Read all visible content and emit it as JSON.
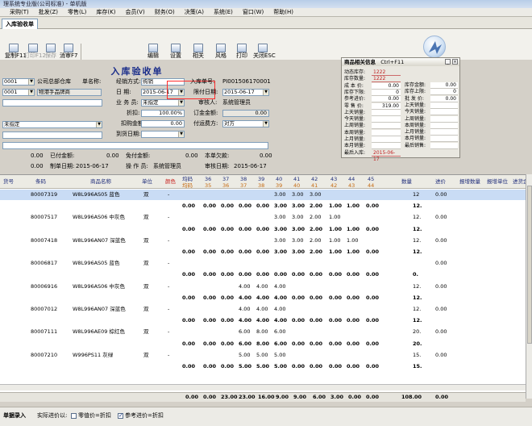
{
  "window": {
    "title": "理系统专业版(公司标准) - 单机版"
  },
  "menu": [
    "采购(T)",
    "批发(Z)",
    "零售(L)",
    "库存(K)",
    "会员(V)",
    "财务(O)",
    "决策(A)",
    "系统(E)",
    "窗口(W)",
    "帮助(H)"
  ],
  "tab": {
    "label": "入库验收单"
  },
  "toolbar": [
    {
      "label": "复制F11"
    },
    {
      "label": "打印F12"
    },
    {
      "label": "保存"
    },
    {
      "label": "存为草稿"
    },
    {
      "label": "消审F7"
    },
    {
      "label": "编辑"
    },
    {
      "label": "设置"
    },
    {
      "label": "相关"
    },
    {
      "label": "风格"
    },
    {
      "label": "打印"
    },
    {
      "label": "关闭ESC"
    }
  ],
  "form": {
    "title": "入库验收单",
    "company_code": "0001",
    "company_name": "公司总部仓库",
    "supplier_label": "单名称:",
    "store_code": "0001",
    "store_name": "物港手品牌商",
    "empty_select1": "",
    "not_set": "未指定",
    "check_method_label": "经销方式:",
    "check_method": "购销",
    "date_label": "日    期:",
    "date": "2015-06-17",
    "order_no_label": "入库单号:",
    "order_no": "PI001506170001",
    "limit_date_label": "限付日期:",
    "limit_date": "2015-06-17",
    "salesman_label": "业 务 员:",
    "salesman": "未指定",
    "auditor_label": "审核人:",
    "auditor": "系统管理员",
    "discount_label": "折扣:",
    "discount": "100.00%",
    "order_amount_label": "订金金额:",
    "order_amount": "0.00",
    "rebate_label": "扣购金额:",
    "rebate": "0.00",
    "pay_method_label": "付运费方:",
    "pay_method": "对方",
    "arrival_label": "到货日期:",
    "arrival": "",
    "inbound_label": "已付金额:",
    "inbound_value": "0.00",
    "paid_label": "免付金额:",
    "paid_value": "0.00",
    "this_debt_label": "本单欠款:",
    "this_debt": "0.00",
    "amount_left": "0.00",
    "amount_left2": "0.00",
    "maker_label": "制单日期:",
    "maker_date": "2015-06-17",
    "operator_label": "操 作 员:",
    "operator": "系统管理员",
    "audit_date_label": "审核日期:",
    "audit_date": "2015-06-17"
  },
  "popup": {
    "title": "商品相关信息",
    "shortcut": "Ctrl+F11",
    "close": "×",
    "left_labels": [
      "动态库存:",
      "库存数量:",
      "成 本 价:",
      "库存下限:",
      "参考进价:",
      "零 售 价:",
      "上天销量:",
      "今天销量:",
      "上周销量:",
      "本周销量:",
      "上月销量:",
      "本月销量:",
      "最后入库:"
    ],
    "left_values": [
      "1222",
      "1222",
      "0.00",
      "0",
      "0.00",
      "319.00",
      "",
      "",
      "",
      "",
      "",
      "",
      "2015-06-17"
    ],
    "right_labels": [
      "库存金额:",
      "库存上限:",
      "批 发 价:",
      "上天销量:",
      "今天销量:",
      "上周销量:",
      "本周销量:",
      "上月销量:",
      "本月销量:",
      "最后销售:"
    ],
    "right_values": [
      "0.00",
      "0",
      "0.00",
      "",
      "",
      "",
      "",
      "",
      "",
      ""
    ]
  },
  "grid": {
    "headers": [
      "货号",
      "条码",
      "商品名称",
      "单位",
      "颜色",
      "数量",
      "进价",
      "报增数量",
      "报增单位",
      "进货金"
    ],
    "size_row1": [
      "均码",
      "36",
      "37",
      "38",
      "39",
      "40",
      "41",
      "42",
      "43",
      "44",
      "45"
    ],
    "size_row2": [
      "均码",
      "35",
      "36",
      "37",
      "38",
      "39",
      "40",
      "41",
      "42",
      "43",
      "44"
    ],
    "rows": [
      {
        "code": "80007319",
        "barcode": "",
        "name": "W8L996AS05 蓝色",
        "unit": "双",
        "color": "-",
        "sizes": [
          "",
          "",
          "",
          "",
          "",
          "3.00",
          "3.00",
          "3.00",
          "",
          "",
          ""
        ],
        "qty": "12",
        "price": "0.00",
        "extra": ""
      },
      {
        "code": "",
        "barcode": "",
        "name": "",
        "unit": "",
        "color": "",
        "sizes": [
          "0.00",
          "0.00",
          "0.00",
          "0.00",
          "0.00",
          "3.00",
          "3.00",
          "2.00",
          "1.00",
          "1.00",
          "0.00"
        ],
        "qty": "12.",
        "price": "",
        "extra": ""
      },
      {
        "code": "80007517",
        "barcode": "",
        "name": "W8L996AS06 中灰色",
        "unit": "双",
        "color": "-",
        "sizes": [
          "",
          "",
          "",
          "",
          "",
          "3.00",
          "3.00",
          "2.00",
          "1.00",
          "",
          ""
        ],
        "qty": "12.",
        "price": "0.00",
        "extra": ""
      },
      {
        "code": "",
        "barcode": "",
        "name": "",
        "unit": "",
        "color": "",
        "sizes": [
          "0.00",
          "0.00",
          "0.00",
          "0.00",
          "0.00",
          "3.00",
          "3.00",
          "2.00",
          "1.00",
          "1.00",
          "0.00"
        ],
        "qty": "12.",
        "price": "",
        "extra": ""
      },
      {
        "code": "80007418",
        "barcode": "",
        "name": "W8L996AN07 深蓝色",
        "unit": "双",
        "color": "-",
        "sizes": [
          "",
          "",
          "",
          "",
          "",
          "3.00",
          "3.00",
          "2.00",
          "1.00",
          "1.00",
          ""
        ],
        "qty": "12.",
        "price": "0.00",
        "extra": ""
      },
      {
        "code": "",
        "barcode": "",
        "name": "",
        "unit": "",
        "color": "",
        "sizes": [
          "0.00",
          "0.00",
          "0.00",
          "0.00",
          "0.00",
          "3.00",
          "3.00",
          "2.00",
          "1.00",
          "1.00",
          "0.00"
        ],
        "qty": "12.",
        "price": "",
        "extra": ""
      },
      {
        "code": "80006817",
        "barcode": "",
        "name": "W8L996AS05 蓝色",
        "unit": "双",
        "color": "-",
        "sizes": [
          "",
          "",
          "",
          "",
          "",
          "",
          "",
          "",
          "",
          "",
          ""
        ],
        "qty": "",
        "price": "0.00",
        "extra": ""
      },
      {
        "code": "",
        "barcode": "",
        "name": "",
        "unit": "",
        "color": "",
        "sizes": [
          "0.00",
          "0.00",
          "0.00",
          "0.00",
          "0.00",
          "0.00",
          "0.00",
          "0.00",
          "0.00",
          "0.00",
          "0.00"
        ],
        "qty": "0.",
        "price": "",
        "extra": ""
      },
      {
        "code": "80006916",
        "barcode": "",
        "name": "W8L996AS06 中灰色",
        "unit": "双",
        "color": "-",
        "sizes": [
          "",
          "",
          "",
          "4.00",
          "4.00",
          "4.00",
          "",
          "",
          "",
          "",
          ""
        ],
        "qty": "12.",
        "price": "0.00",
        "extra": ""
      },
      {
        "code": "",
        "barcode": "",
        "name": "",
        "unit": "",
        "color": "",
        "sizes": [
          "0.00",
          "0.00",
          "0.00",
          "4.00",
          "4.00",
          "4.00",
          "0.00",
          "0.00",
          "0.00",
          "0.00",
          "0.00"
        ],
        "qty": "12.",
        "price": "",
        "extra": ""
      },
      {
        "code": "80007012",
        "barcode": "",
        "name": "W8L996AN07 深蓝色",
        "unit": "双",
        "color": "-",
        "sizes": [
          "",
          "",
          "",
          "4.00",
          "4.00",
          "4.00",
          "",
          "",
          "",
          "",
          ""
        ],
        "qty": "12.",
        "price": "0.00",
        "extra": ""
      },
      {
        "code": "",
        "barcode": "",
        "name": "",
        "unit": "",
        "color": "",
        "sizes": [
          "0.00",
          "0.00",
          "0.00",
          "4.00",
          "4.00",
          "4.00",
          "0.00",
          "0.00",
          "0.00",
          "0.00",
          "0.00"
        ],
        "qty": "12.",
        "price": "",
        "extra": ""
      },
      {
        "code": "80007111",
        "barcode": "",
        "name": "W8L996AE09 棕红色",
        "unit": "双",
        "color": "-",
        "sizes": [
          "",
          "",
          "",
          "6.00",
          "8.00",
          "6.00",
          "",
          "",
          "",
          "",
          ""
        ],
        "qty": "20.",
        "price": "0.00",
        "extra": ""
      },
      {
        "code": "",
        "barcode": "",
        "name": "",
        "unit": "",
        "color": "",
        "sizes": [
          "0.00",
          "0.00",
          "0.00",
          "6.00",
          "8.00",
          "6.00",
          "0.00",
          "0.00",
          "0.00",
          "0.00",
          "0.00"
        ],
        "qty": "20.",
        "price": "",
        "extra": ""
      },
      {
        "code": "80007210",
        "barcode": "",
        "name": "W996PS11 灰绿",
        "unit": "双",
        "color": "-",
        "sizes": [
          "",
          "",
          "",
          "5.00",
          "5.00",
          "5.00",
          "",
          "",
          "",
          "",
          ""
        ],
        "qty": "15.",
        "price": "0.00",
        "extra": ""
      },
      {
        "code": "",
        "barcode": "",
        "name": "",
        "unit": "",
        "color": "",
        "sizes": [
          "0.00",
          "0.00",
          "0.00",
          "5.00",
          "5.00",
          "5.00",
          "0.00",
          "0.00",
          "0.00",
          "0.00",
          "0.00"
        ],
        "qty": "15.",
        "price": "",
        "extra": ""
      }
    ]
  },
  "totals": {
    "sizes": [
      "0.00",
      "0.00",
      "23.00",
      "23.00",
      "16.00",
      "9.00",
      "9.00",
      "6.00",
      "3.00",
      "0.00",
      "0.00"
    ],
    "qty": "108.00",
    "price": "0.00"
  },
  "status": {
    "left_label": "单据录入",
    "price_label": "实际进价以:",
    "opt1": "零值价=折扣",
    "opt2": "参考进价=折扣"
  }
}
